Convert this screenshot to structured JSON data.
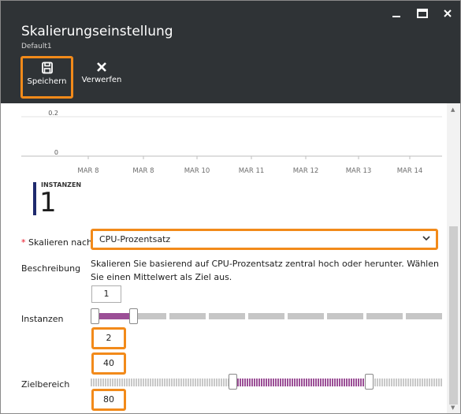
{
  "window": {
    "title": "Skalierungseinstellung",
    "subtitle": "Default1"
  },
  "commands": {
    "save_label": "Speichern",
    "discard_label": "Verwerfen"
  },
  "chart_data": {
    "type": "line",
    "y_ticks": [
      "0.2",
      "0"
    ],
    "x_ticks": [
      "MAR 8",
      "MAR 8",
      "MAR 10",
      "MAR 11",
      "MAR 12",
      "MAR 13",
      "MAR 14"
    ],
    "ylim": [
      0,
      0.2
    ],
    "series": []
  },
  "instances_summary": {
    "label": "INSTANZEN",
    "value": "1"
  },
  "scale_by": {
    "label": "Skalieren nach",
    "required_marker": "*",
    "selected": "CPU-Prozentsatz"
  },
  "description": {
    "label": "Beschreibung",
    "text": "Skalieren Sie basierend auf CPU-Prozentsatz zentral hoch oder herunter. Wählen Sie einen Mittelwert als Ziel aus."
  },
  "instances_range": {
    "label": "Instanzen",
    "min_value": "1",
    "max_value": "2",
    "min_fraction": 0.0,
    "max_fraction": 0.11
  },
  "target_range": {
    "label": "Zielbereich",
    "min_value": "40",
    "max_value": "80",
    "min_fraction": 0.4,
    "max_fraction": 0.8
  },
  "colors": {
    "header_bg": "#2f3336",
    "highlight": "#f28a1a",
    "slider_fill": "#9b4f96",
    "instance_bar": "#1f2a6e"
  }
}
